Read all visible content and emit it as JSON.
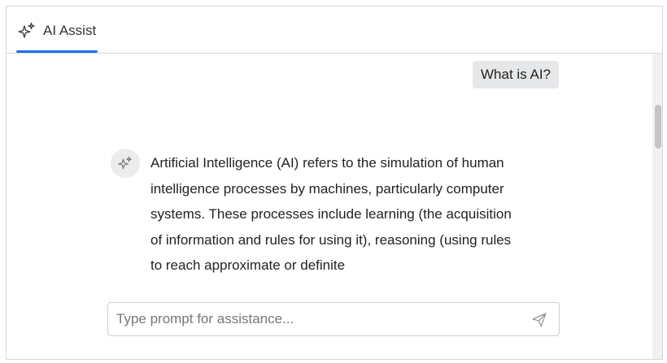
{
  "tabs": [
    {
      "label": "AI Assist",
      "icon": "sparkle-icon",
      "active": true
    }
  ],
  "colors": {
    "accent": "#1a73e8",
    "user_bubble": "#e6e7e8"
  },
  "conversation": {
    "user_message": "What is AI?",
    "assistant_message": "Artificial Intelligence (AI) refers to the simulation of human intelligence processes by machines, particularly computer systems. These processes include learning (the acquisition of information and rules for using it), reasoning (using rules to reach approximate or definite"
  },
  "prompt": {
    "value": "",
    "placeholder": "Type prompt for assistance...",
    "send_icon": "send-icon"
  }
}
